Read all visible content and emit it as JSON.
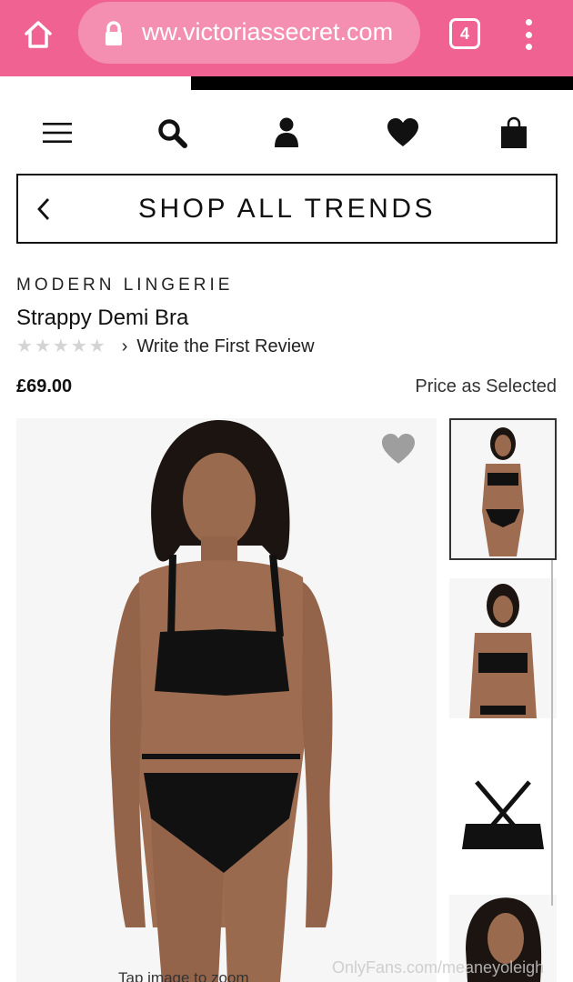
{
  "browser": {
    "url": "ww.victoriassecret.com",
    "tab_count": "4",
    "icons": {
      "home": "home-icon",
      "lock": "lock-icon",
      "more": "more-vert-icon"
    }
  },
  "colors": {
    "chrome": "#f06292",
    "urlbar": "#f48fb1"
  },
  "nav": {
    "icons": [
      "menu-icon",
      "search-icon",
      "account-icon",
      "wishlist-heart-icon",
      "shopping-bag-icon"
    ]
  },
  "breadcrumb": {
    "label": "SHOP ALL TRENDS"
  },
  "product": {
    "category": "MODERN LINGERIE",
    "name": "Strappy Demi Bra",
    "rating": 0,
    "review_link": "Write the First Review",
    "price": "£69.00",
    "price_note": "Price as Selected"
  },
  "gallery": {
    "thumbnail_count": 4,
    "selected_index": 0
  },
  "caption": "Tap image to zoom",
  "watermark": "OnlyFans.com/meaneyoleigh"
}
